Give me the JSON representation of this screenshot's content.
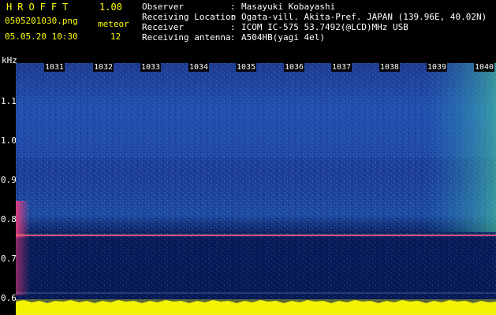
{
  "header": {
    "app_title": "HROFFT",
    "app_version": "1.00",
    "filename": "0505201030.png",
    "meteor_label": "meteor",
    "datetime": "05.05.20 10:30",
    "meteor_count": "12"
  },
  "info": [
    {
      "key": "Observer",
      "value": "Masayuki Kobayashi"
    },
    {
      "key": "Receiving Location",
      "value": "Ogata-vill. Akita-Pref. JAPAN (139.96E, 40.02N)"
    },
    {
      "key": "Receiver",
      "value": "ICOM IC-575 53.7492(@LCD)MHz USB"
    },
    {
      "key": "Receiving antenna",
      "value": "A504HB(yagi 4el)"
    }
  ],
  "info_separator": ":",
  "axis": {
    "unit": "kHz",
    "ticks": [
      "1.1",
      "1.0",
      "0.9",
      "0.8",
      "0.7",
      "0.6"
    ]
  },
  "minute_markers": [
    "1031",
    "1032",
    "1033",
    "1034",
    "1035",
    "1036",
    "1037",
    "1038",
    "1039",
    "1040"
  ],
  "colors": {
    "header_yellow": "#ffff00",
    "spectrum_base": "#1f48a6",
    "signal_band": "#ffff00",
    "carrier_line": "#ff4080"
  }
}
